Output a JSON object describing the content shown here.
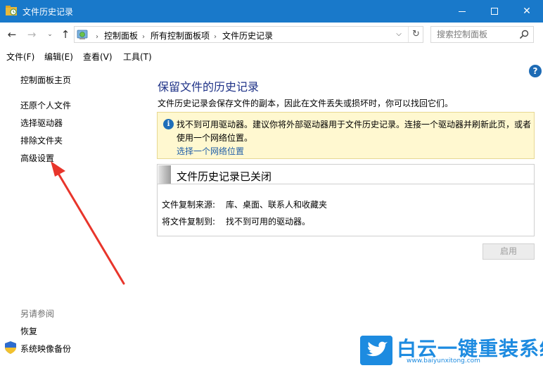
{
  "window": {
    "title": "文件历史记录",
    "colors": {
      "titlebar": "#1979ca",
      "link": "#1f5ea8",
      "heading": "#1e3287",
      "info_bg": "#fff8d0"
    }
  },
  "address": {
    "crumbs": [
      "控制面板",
      "所有控制面板项",
      "文件历史记录"
    ]
  },
  "search": {
    "placeholder": "搜索控制面板"
  },
  "menu": {
    "items": [
      {
        "label": "文件(F)"
      },
      {
        "label": "编辑(E)"
      },
      {
        "label": "查看(V)"
      },
      {
        "label": "工具(T)"
      }
    ]
  },
  "sidebar": {
    "home": "控制面板主页",
    "items": [
      {
        "label": "还原个人文件"
      },
      {
        "label": "选择驱动器"
      },
      {
        "label": "排除文件夹"
      },
      {
        "label": "高级设置"
      }
    ],
    "see_also_label": "另请参阅",
    "see_also": [
      {
        "label": "恢复"
      },
      {
        "label": "系统映像备份"
      }
    ]
  },
  "main": {
    "title": "保留文件的历史记录",
    "description": "文件历史记录会保存文件的副本，因此在文件丢失或损坏时，你可以找回它们。",
    "info": {
      "text": "找不到可用驱动器。建议你将外部驱动器用于文件历史记录。连接一个驱动器并刷新此页，或者使用一个网络位置。",
      "link": "选择一个网络位置"
    },
    "status": {
      "title": "文件历史记录已关闭",
      "copy_from_label": "文件复制来源:",
      "copy_from_value": "库、桌面、联系人和收藏夹",
      "copy_to_label": "将文件复制到:",
      "copy_to_value": "找不到可用的驱动器。"
    },
    "enable_button": "启用"
  },
  "watermark": {
    "big": "白云一键重装系统",
    "small": "www.baiyunxitong.com"
  }
}
